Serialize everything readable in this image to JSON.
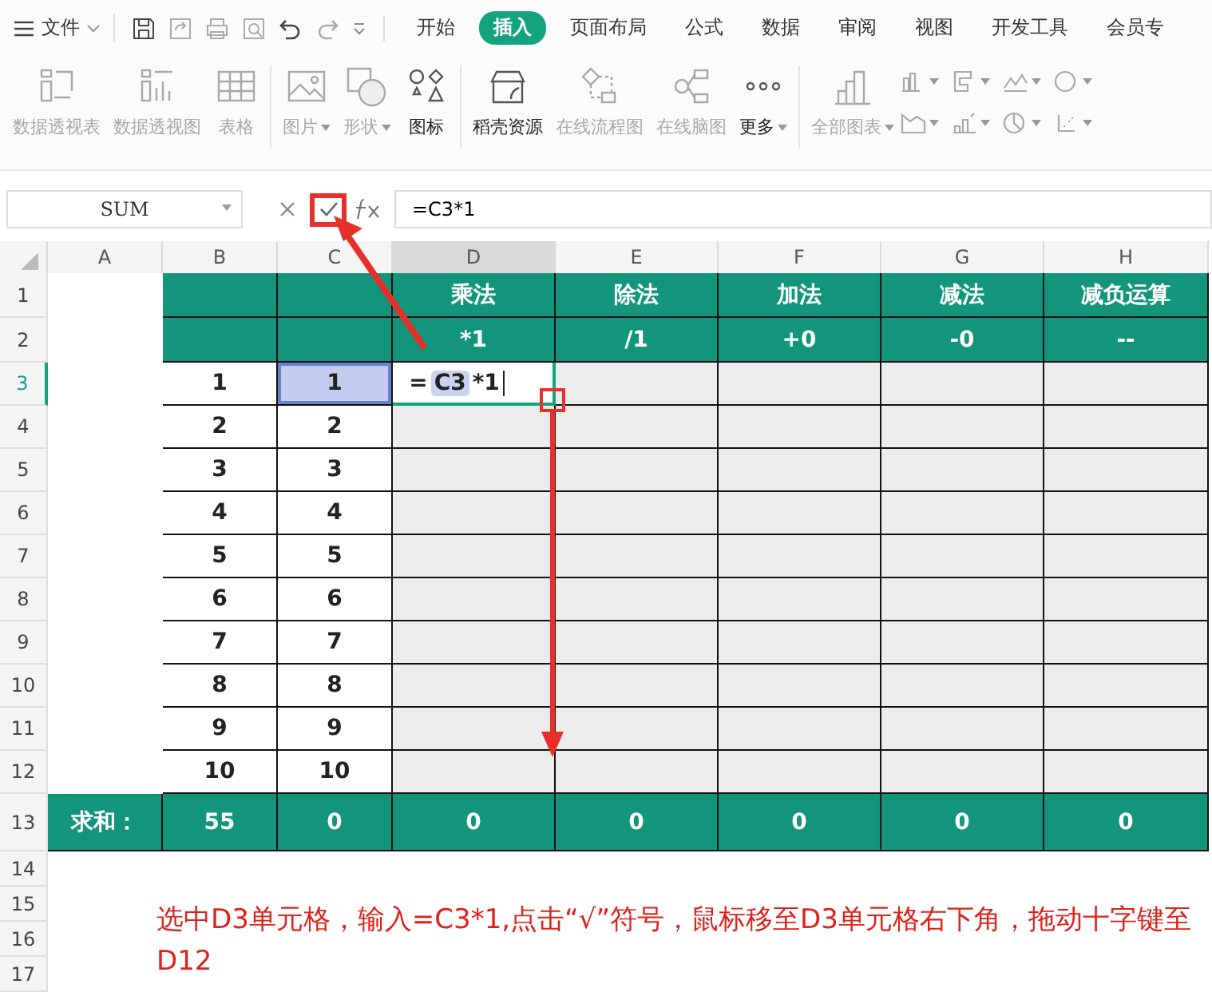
{
  "menu": {
    "file": "文件",
    "tabs": [
      {
        "label": "开始",
        "selected": false
      },
      {
        "label": "插入",
        "selected": true
      },
      {
        "label": "页面布局",
        "selected": false
      },
      {
        "label": "公式",
        "selected": false
      },
      {
        "label": "数据",
        "selected": false
      },
      {
        "label": "审阅",
        "selected": false
      },
      {
        "label": "视图",
        "selected": false
      },
      {
        "label": "开发工具",
        "selected": false
      },
      {
        "label": "会员专",
        "selected": false
      }
    ]
  },
  "ribbon": [
    {
      "label": "数据透视表",
      "disabled": true,
      "dropdown": false
    },
    {
      "label": "数据透视图",
      "disabled": true,
      "dropdown": false
    },
    {
      "label": "表格",
      "disabled": true,
      "dropdown": false
    },
    {
      "label": "图片",
      "disabled": true,
      "dropdown": true
    },
    {
      "label": "形状",
      "disabled": true,
      "dropdown": true
    },
    {
      "label": "图标",
      "disabled": false,
      "dropdown": false
    },
    {
      "label": "稻壳资源",
      "disabled": false,
      "dropdown": false
    },
    {
      "label": "在线流程图",
      "disabled": true,
      "dropdown": false
    },
    {
      "label": "在线脑图",
      "disabled": true,
      "dropdown": false
    },
    {
      "label": "更多",
      "disabled": false,
      "dropdown": true
    },
    {
      "label": "全部图表",
      "disabled": true,
      "dropdown": true
    }
  ],
  "formula_bar": {
    "name_box": "SUM",
    "formula": "=C3*1"
  },
  "columns": [
    {
      "label": "A",
      "selected": false
    },
    {
      "label": "B",
      "selected": false
    },
    {
      "label": "C",
      "selected": false
    },
    {
      "label": "D",
      "selected": true
    },
    {
      "label": "E",
      "selected": false
    },
    {
      "label": "F",
      "selected": false
    },
    {
      "label": "G",
      "selected": false
    },
    {
      "label": "H",
      "selected": false
    }
  ],
  "rows": [
    {
      "num": "1",
      "kind": "header",
      "selected": false,
      "cells": [
        {
          "selected": false
        },
        {
          "selected": false
        },
        {
          "selected": false
        },
        {
          "text": "乘法",
          "selected": false
        },
        {
          "text": "除法",
          "selected": false
        },
        {
          "text": "加法",
          "selected": false
        },
        {
          "text": "减法",
          "selected": false
        },
        {
          "text": "减负运算",
          "selected": false
        }
      ]
    },
    {
      "num": "2",
      "kind": "header",
      "selected": false,
      "cells": [
        {
          "selected": false
        },
        {
          "selected": false
        },
        {
          "selected": false
        },
        {
          "text": "*1",
          "selected": false
        },
        {
          "text": "/1",
          "selected": false
        },
        {
          "text": "+0",
          "selected": false
        },
        {
          "text": "-0",
          "selected": false
        },
        {
          "text": "--",
          "selected": false
        }
      ]
    },
    {
      "num": "3",
      "kind": "data",
      "selected": true,
      "cells": [
        {
          "selected": false
        },
        {
          "text": "1",
          "selected": false
        },
        {
          "text": "1",
          "selected": true
        },
        {
          "selected": false,
          "editing": [
            "=",
            "C3",
            "*1"
          ]
        },
        {
          "selected": false
        },
        {
          "selected": false
        },
        {
          "selected": false
        },
        {
          "selected": false
        }
      ]
    },
    {
      "num": "4",
      "kind": "data",
      "selected": false,
      "cells": [
        {
          "selected": false
        },
        {
          "text": "2",
          "selected": false
        },
        {
          "text": "2",
          "selected": false
        },
        {
          "selected": false
        },
        {
          "selected": false
        },
        {
          "selected": false
        },
        {
          "selected": false
        },
        {
          "selected": false
        }
      ]
    },
    {
      "num": "5",
      "kind": "data",
      "selected": false,
      "cells": [
        {
          "selected": false
        },
        {
          "text": "3",
          "selected": false
        },
        {
          "text": "3",
          "selected": false
        },
        {
          "selected": false
        },
        {
          "selected": false
        },
        {
          "selected": false
        },
        {
          "selected": false
        },
        {
          "selected": false
        }
      ]
    },
    {
      "num": "6",
      "kind": "data",
      "selected": false,
      "cells": [
        {
          "selected": false
        },
        {
          "text": "4",
          "selected": false
        },
        {
          "text": "4",
          "selected": false
        },
        {
          "selected": false
        },
        {
          "selected": false
        },
        {
          "selected": false
        },
        {
          "selected": false
        },
        {
          "selected": false
        }
      ]
    },
    {
      "num": "7",
      "kind": "data",
      "selected": false,
      "cells": [
        {
          "selected": false
        },
        {
          "text": "5",
          "selected": false
        },
        {
          "text": "5",
          "selected": false
        },
        {
          "selected": false
        },
        {
          "selected": false
        },
        {
          "selected": false
        },
        {
          "selected": false
        },
        {
          "selected": false
        }
      ]
    },
    {
      "num": "8",
      "kind": "data",
      "selected": false,
      "cells": [
        {
          "selected": false
        },
        {
          "text": "6",
          "selected": false
        },
        {
          "text": "6",
          "selected": false
        },
        {
          "selected": false
        },
        {
          "selected": false
        },
        {
          "selected": false
        },
        {
          "selected": false
        },
        {
          "selected": false
        }
      ]
    },
    {
      "num": "9",
      "kind": "data",
      "selected": false,
      "cells": [
        {
          "selected": false
        },
        {
          "text": "7",
          "selected": false
        },
        {
          "text": "7",
          "selected": false
        },
        {
          "selected": false
        },
        {
          "selected": false
        },
        {
          "selected": false
        },
        {
          "selected": false
        },
        {
          "selected": false
        }
      ]
    },
    {
      "num": "10",
      "kind": "data",
      "selected": false,
      "cells": [
        {
          "selected": false
        },
        {
          "text": "8",
          "selected": false
        },
        {
          "text": "8",
          "selected": false
        },
        {
          "selected": false
        },
        {
          "selected": false
        },
        {
          "selected": false
        },
        {
          "selected": false
        },
        {
          "selected": false
        }
      ]
    },
    {
      "num": "11",
      "kind": "data",
      "selected": false,
      "cells": [
        {
          "selected": false
        },
        {
          "text": "9",
          "selected": false
        },
        {
          "text": "9",
          "selected": false
        },
        {
          "selected": false
        },
        {
          "selected": false
        },
        {
          "selected": false
        },
        {
          "selected": false
        },
        {
          "selected": false
        }
      ]
    },
    {
      "num": "12",
      "kind": "data",
      "selected": false,
      "cells": [
        {
          "selected": false
        },
        {
          "text": "10",
          "selected": false
        },
        {
          "text": "10",
          "selected": false
        },
        {
          "selected": false
        },
        {
          "selected": false
        },
        {
          "selected": false
        },
        {
          "selected": false
        },
        {
          "selected": false
        }
      ]
    },
    {
      "num": "13",
      "kind": "sum",
      "selected": false,
      "cells": [
        {
          "text": "求和：",
          "selected": false
        },
        {
          "text": "55",
          "selected": false
        },
        {
          "text": "0",
          "selected": false
        },
        {
          "text": "0",
          "selected": false
        },
        {
          "text": "0",
          "selected": false
        },
        {
          "text": "0",
          "selected": false
        },
        {
          "text": "0",
          "selected": false
        },
        {
          "text": "0",
          "selected": false
        }
      ]
    },
    {
      "num": "14",
      "kind": "blank",
      "selected": false
    },
    {
      "num": "15",
      "kind": "blank",
      "selected": false
    },
    {
      "num": "16",
      "kind": "blank",
      "selected": false
    },
    {
      "num": "17",
      "kind": "blank",
      "selected": false
    }
  ],
  "annotation": "选中D3单元格，输入=C3*1,点击“√”符号，鼠标移至D3单元格右下角，拖动十字键至D12"
}
